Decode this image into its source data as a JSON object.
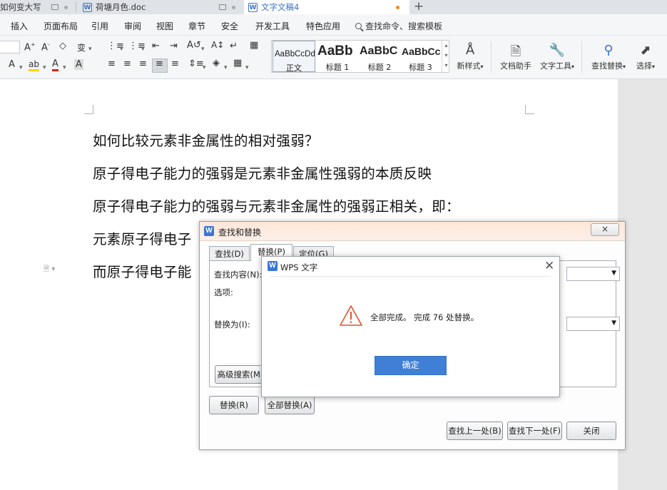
{
  "tabs": [
    {
      "label": "如何变大写",
      "active": false
    },
    {
      "label": "荷塘月色.doc",
      "active": false
    },
    {
      "label": "文字文稿4",
      "active": true
    }
  ],
  "new_tab": "+",
  "menu": {
    "items": [
      "插入",
      "页面布局",
      "引用",
      "审阅",
      "视图",
      "章节",
      "安全",
      "开发工具",
      "特色应用"
    ],
    "search_placeholder": "查找命令、搜索模板"
  },
  "ribbon": {
    "styles": [
      {
        "sample": "AaBbCcDd",
        "name": "正文"
      },
      {
        "sample": "AaBb",
        "name": "标题 1"
      },
      {
        "sample": "AaBbC",
        "name": "标题 2"
      },
      {
        "sample": "AaBbCc",
        "name": "标题 3"
      }
    ],
    "new_style": "新样式",
    "doc_assistant": "文档助手",
    "text_tools": "文字工具",
    "find_replace": "查找替换",
    "select": "选择"
  },
  "document": {
    "paragraphs": [
      "如何比较元素非金属性的相对强弱？",
      "原子得电子能力的强弱是元素非金属性强弱的本质反映",
      "原子得电子能力的强弱与元素非金属性的强弱正相关，即：",
      "元素原子得电子",
      "而原子得电子能"
    ]
  },
  "find_dialog": {
    "title": "查找和替换",
    "close": "×",
    "tabs": [
      "查找(D)",
      "替换(P)",
      "定位(G)"
    ],
    "find_label": "查找内容(N):",
    "options_label": "选项:",
    "replace_label": "替换为(I):",
    "advanced": "高级搜索(M)",
    "replace": "替换(R)",
    "replace_all": "全部替换(A)",
    "find_prev": "查找上一处(B)",
    "find_next": "查找下一处(F)",
    "close_btn": "关闭"
  },
  "alert": {
    "title": "WPS 文字",
    "message": "全部完成。 完成 76 处替换。",
    "ok": "确定"
  },
  "colors": {
    "accent": "#3f7fd6",
    "warning": "#e0522e",
    "tab_active_dot": "#f08a24"
  }
}
